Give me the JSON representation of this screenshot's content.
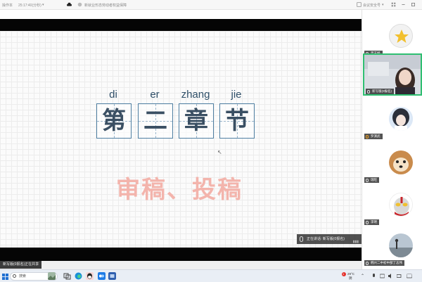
{
  "topbar": {
    "left_label": "操作本",
    "time": "25:17:40(分秒)",
    "meeting_title": "新就业形态劳动者权益保障",
    "right_label": "会议安全号"
  },
  "slide": {
    "pinyin": [
      "di",
      "er",
      "zhang",
      "jie"
    ],
    "chars": [
      "第",
      "二",
      "章",
      "节"
    ],
    "title": "审稿、投稿"
  },
  "speaking": {
    "prefix": "正在讲话:",
    "name": "新写版(0报名)"
  },
  "share_label": "新写版(0报名)正在共享",
  "participants": [
    {
      "name": "曾玉娟",
      "active": false,
      "avatar": "star-avatar"
    },
    {
      "name": "新写版(0报名)",
      "active": true,
      "avatar": "video-girl"
    },
    {
      "name": "罗演武",
      "active": false,
      "avatar": "anime-avatar"
    },
    {
      "name": "瑞旺",
      "active": false,
      "avatar": "dog-avatar"
    },
    {
      "name": "李明",
      "active": false,
      "avatar": "ultraman-avatar"
    },
    {
      "name": "韩兴二中初中部丁志伟",
      "active": false,
      "avatar": "landscape-avatar"
    }
  ],
  "taskbar": {
    "search_placeholder": "搜索",
    "weather_temp": "29°C",
    "weather_desc": "阴",
    "notification_count": "1"
  },
  "colors": {
    "accent_green": "#2fbf71",
    "char_box_blue": "#4f7fa2",
    "title_pink": "#f3b4ac"
  }
}
